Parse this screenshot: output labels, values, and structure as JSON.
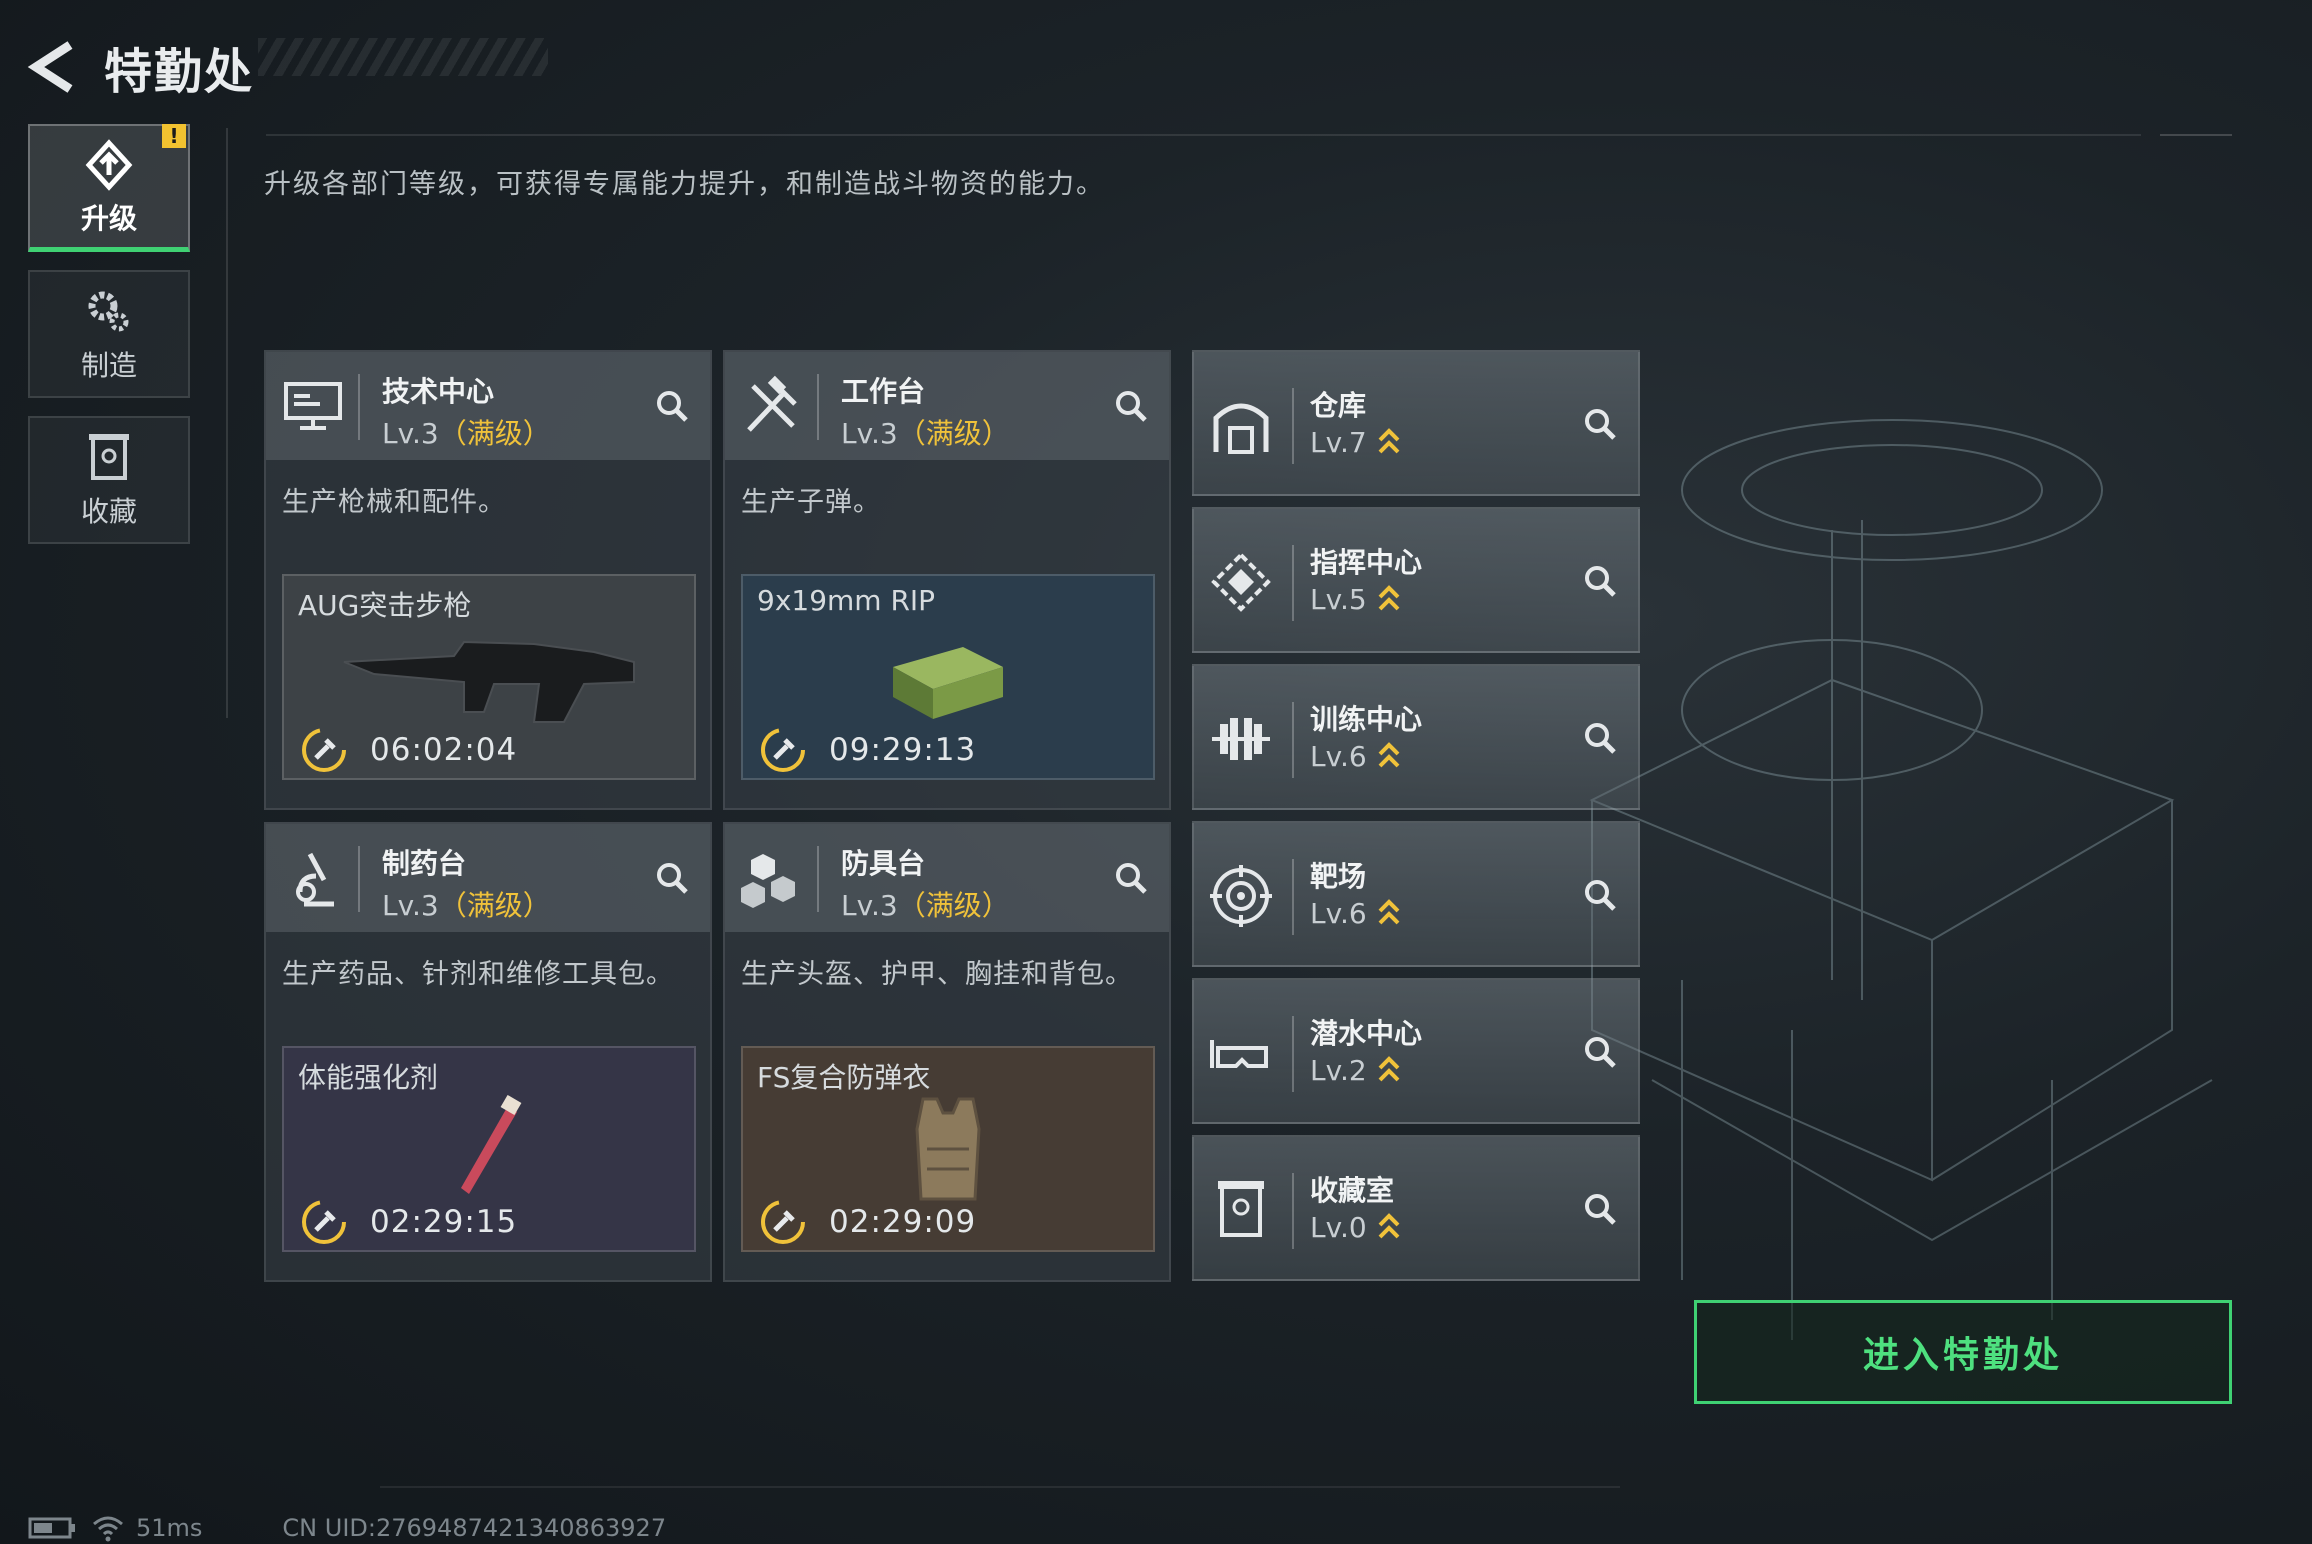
{
  "header": {
    "title": "特勤处"
  },
  "subtitle": "升级各部门等级，可获得专属能力提升，和制造战斗物资的能力。",
  "nav": {
    "items": [
      {
        "label": "升级",
        "icon": "upgrade-icon",
        "active": true,
        "badge": "!"
      },
      {
        "label": "制造",
        "icon": "gear-icon",
        "active": false
      },
      {
        "label": "收藏",
        "icon": "collection-icon",
        "active": false
      }
    ]
  },
  "cards": [
    {
      "name": "技术中心",
      "level": "Lv.3",
      "max": "（满级）",
      "icon": "monitor-icon",
      "desc": "生产枪械和配件。",
      "item": {
        "name": "AUG突击步枪",
        "timer": "06:02:04",
        "bg": "#3d4246"
      }
    },
    {
      "name": "工作台",
      "level": "Lv.3",
      "max": "（满级）",
      "icon": "tools-icon",
      "desc": "生产子弹。",
      "item": {
        "name": "9x19mm RIP",
        "timer": "09:29:13",
        "bg": "#2b3d4c"
      }
    },
    {
      "name": "制药台",
      "level": "Lv.3",
      "max": "（满级）",
      "icon": "microscope-icon",
      "desc": "生产药品、针剂和维修工具包。",
      "item": {
        "name": "体能强化剂",
        "timer": "02:29:15",
        "bg": "#353547"
      }
    },
    {
      "name": "防具台",
      "level": "Lv.3",
      "max": "（满级）",
      "icon": "boxes-icon",
      "desc": "生产头盔、护甲、胸挂和背包。",
      "item": {
        "name": "FS复合防弹衣",
        "timer": "02:29:09",
        "bg": "#463c34"
      }
    }
  ],
  "rooms": [
    {
      "name": "仓库",
      "level": "Lv.7",
      "icon": "warehouse-icon"
    },
    {
      "name": "指挥中心",
      "level": "Lv.5",
      "icon": "command-icon"
    },
    {
      "name": "训练中心",
      "level": "Lv.6",
      "icon": "dumbbell-icon"
    },
    {
      "name": "靶场",
      "level": "Lv.6",
      "icon": "target-icon"
    },
    {
      "name": "潜水中心",
      "level": "Lv.2",
      "icon": "goggles-icon"
    },
    {
      "name": "收藏室",
      "level": "Lv.0",
      "icon": "collection-icon"
    }
  ],
  "enter_button": "进入特勤处",
  "status": {
    "ping": "51ms",
    "uid": "CN UID:27694874213408639​27"
  },
  "colors": {
    "accent": "#3fd173",
    "max_level": "#f0c23a",
    "upgrade_arrow": "#f0c23a"
  }
}
